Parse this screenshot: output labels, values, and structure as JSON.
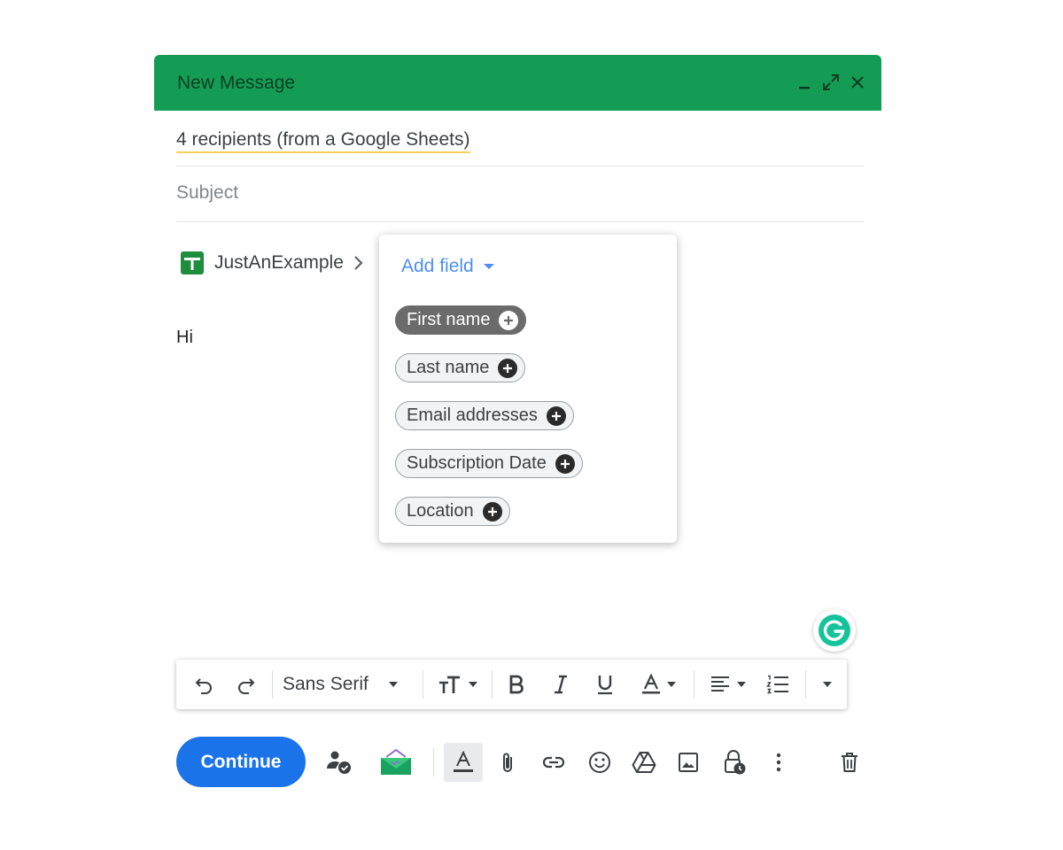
{
  "header": {
    "title": "New Message"
  },
  "recipients": {
    "text": "4 recipients (from a Google Sheets)"
  },
  "subject": {
    "placeholder": "Subject"
  },
  "sheet": {
    "name": "JustAnExample"
  },
  "body": {
    "text": "Hi"
  },
  "popup": {
    "title": "Add field",
    "fields": [
      {
        "label": "First name",
        "active": true
      },
      {
        "label": "Last name",
        "active": false
      },
      {
        "label": "Email addresses",
        "active": false
      },
      {
        "label": "Subscription Date",
        "active": false
      },
      {
        "label": "Location",
        "active": false
      }
    ]
  },
  "toolbar": {
    "font": "Sans Serif"
  },
  "bottom": {
    "send_label": "Continue"
  },
  "colors": {
    "header_bg": "#149c55",
    "send_bg": "#1a73e8",
    "link": "#4d8ef0"
  }
}
